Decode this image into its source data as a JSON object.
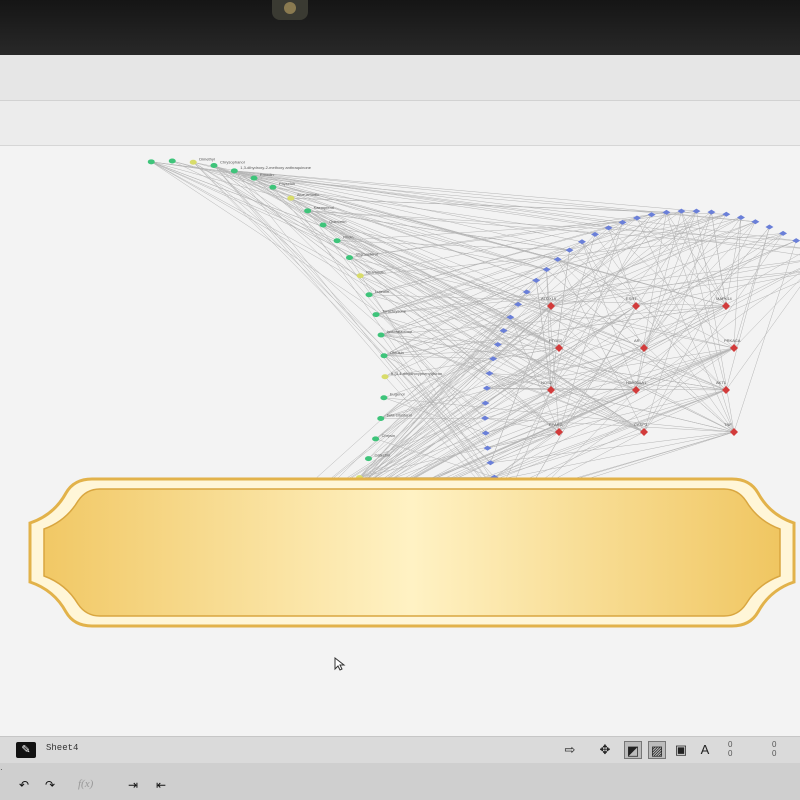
{
  "canvas": {
    "left_cluster_labels": [
      "Dimethyl",
      "Chrysophanol",
      "1,3-dihydroxy-2-methoxy anthraquinone",
      "Emodin",
      "Physcion",
      "Aloe-emodin",
      "Kaempferol",
      "Quercetin",
      "Rhein",
      "Stigmasterol",
      "Rhamnetin",
      "Luteolin",
      "Torachrysone",
      "Isotoralactone",
      "Obtusin",
      "6-(3,4-dihydroxyphenyl)furan",
      "Eugenol",
      "beta-sitosterol",
      "Chrysin",
      "Catechin"
    ],
    "right_red_labels": [
      "ALOX15",
      "PTGS2",
      "NOS2",
      "PPARG",
      "ESR1",
      "AR",
      "HSP90AA1",
      "CASP3",
      "MAPK14",
      "PRKACA",
      "AKT1",
      "TNF"
    ],
    "colors": {
      "green_node": "#3ec47a",
      "yellow_node": "#d8dc6a",
      "blue_node": "#6a7fd8",
      "red_node": "#d23b3b",
      "edge": "#9a9a9a",
      "banner_gold": "#f6dc8e"
    }
  },
  "banner": {
    "text": ""
  },
  "statusbar": {
    "sheet_button_icon": "edit-icon",
    "sheet_name": "Sheet4",
    "counter_top_left": "0",
    "counter_top_right": "0",
    "counter_bottom_left": "0",
    "counter_bottom_right": "0"
  },
  "bottombar": {
    "fx_label": "f(x)"
  }
}
